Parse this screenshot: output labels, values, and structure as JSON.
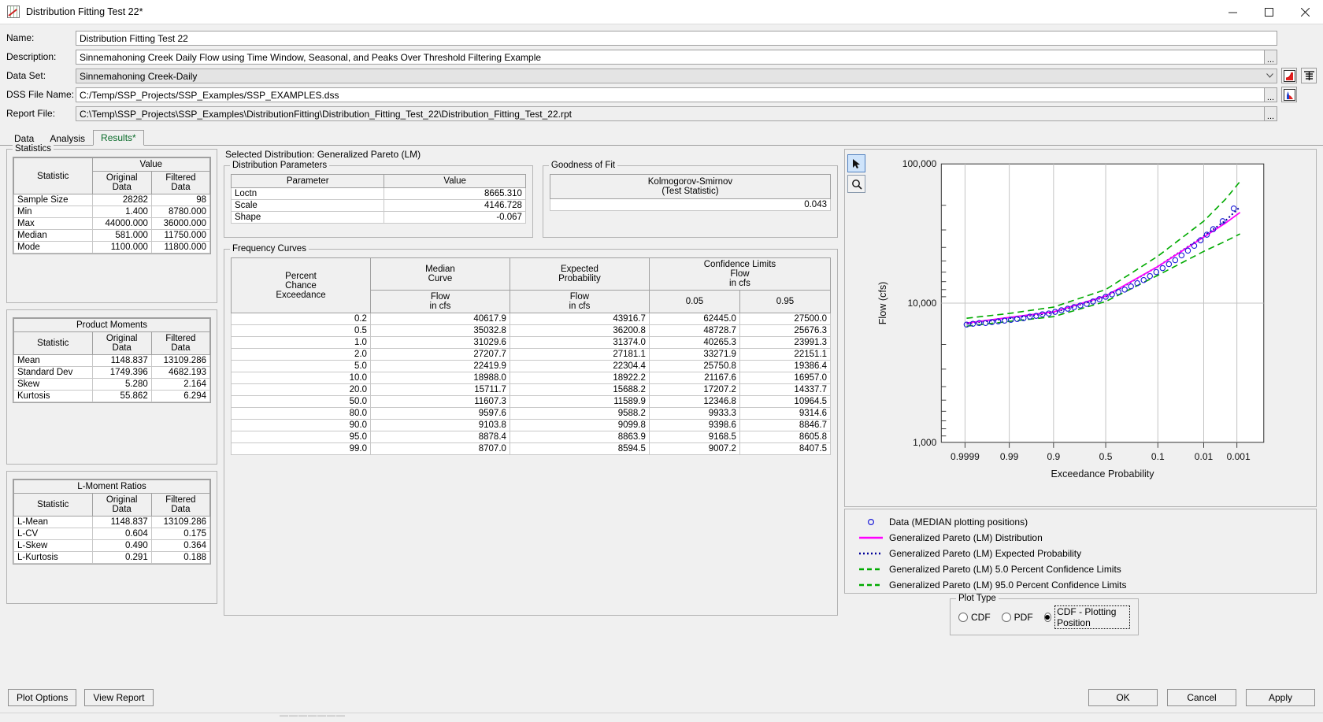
{
  "window": {
    "title": "Distribution Fitting Test 22*",
    "icon": "chart-icon",
    "minimize": "–",
    "maximize": "☐",
    "close": "✕"
  },
  "form": {
    "name_label": "Name:",
    "name_value": "Distribution Fitting Test 22",
    "description_label": "Description:",
    "description_value": "Sinnemahoning Creek Daily Flow using Time Window, Seasonal, and Peaks Over Threshold Filtering Example",
    "dataset_label": "Data Set:",
    "dataset_value": "Sinnemahoning Creek-Daily",
    "dss_label": "DSS File Name:",
    "dss_value": "C:/Temp/SSP_Projects/SSP_Examples/SSP_EXAMPLES.dss",
    "report_label": "Report File:",
    "report_value": "C:\\Temp\\SSP_Projects\\SSP_Examples\\DistributionFitting\\Distribution_Fitting_Test_22\\Distribution_Fitting_Test_22.rpt",
    "browse_label": "..."
  },
  "tabs": [
    {
      "label": "Data",
      "active": false
    },
    {
      "label": "Analysis",
      "active": false
    },
    {
      "label": "Results*",
      "active": true
    }
  ],
  "statistics": {
    "group_title": "Statistics",
    "header_statistic": "Statistic",
    "header_value": "Value",
    "header_original": "Original Data",
    "header_filtered": "Filtered Data",
    "rows": [
      {
        "stat": "Sample Size",
        "original": "28282",
        "filtered": "98"
      },
      {
        "stat": "Min",
        "original": "1.400",
        "filtered": "8780.000"
      },
      {
        "stat": "Max",
        "original": "44000.000",
        "filtered": "36000.000"
      },
      {
        "stat": "Median",
        "original": "581.000",
        "filtered": "11750.000"
      },
      {
        "stat": "Mode",
        "original": "1100.000",
        "filtered": "11800.000"
      }
    ]
  },
  "product_moments": {
    "title": "Product Moments",
    "header_statistic": "Statistic",
    "header_original": "Original Data",
    "header_filtered": "Filtered Data",
    "rows": [
      {
        "stat": "Mean",
        "original": "1148.837",
        "filtered": "13109.286"
      },
      {
        "stat": "Standard Dev",
        "original": "1749.396",
        "filtered": "4682.193"
      },
      {
        "stat": "Skew",
        "original": "5.280",
        "filtered": "2.164"
      },
      {
        "stat": "Kurtosis",
        "original": "55.862",
        "filtered": "6.294"
      }
    ]
  },
  "lmoment_ratios": {
    "title": "L-Moment Ratios",
    "header_statistic": "Statistic",
    "header_original": "Original Data",
    "header_filtered": "Filtered Data",
    "rows": [
      {
        "stat": "L-Mean",
        "original": "1148.837",
        "filtered": "13109.286"
      },
      {
        "stat": "L-CV",
        "original": "0.604",
        "filtered": "0.175"
      },
      {
        "stat": "L-Skew",
        "original": "0.490",
        "filtered": "0.364"
      },
      {
        "stat": "L-Kurtosis",
        "original": "0.291",
        "filtered": "0.188"
      }
    ]
  },
  "selected_distribution": "Selected Distribution: Generalized Pareto (LM)",
  "distribution_parameters": {
    "group_title": "Distribution Parameters",
    "header_parameter": "Parameter",
    "header_value": "Value",
    "rows": [
      {
        "parameter": "Loctn",
        "value": "8665.310"
      },
      {
        "parameter": "Scale",
        "value": "4146.728"
      },
      {
        "parameter": "Shape",
        "value": "-0.067"
      }
    ]
  },
  "goodness_of_fit": {
    "group_title": "Goodness of Fit",
    "header_line1": "Kolmogorov-Smirnov",
    "header_line2": "(Test Statistic)",
    "value": "0.043"
  },
  "frequency_curves": {
    "group_title": "Frequency Curves",
    "header_percent": "Percent\nChance\nExceedance",
    "header_percent_l1": "Percent",
    "header_percent_l2": "Chance",
    "header_percent_l3": "Exceedance",
    "header_median_l1": "Median",
    "header_median_l2": "Curve",
    "header_expected_l1": "Expected",
    "header_expected_l2": "Probability",
    "header_confidence_l1": "Confidence Limits",
    "header_confidence_l2": "Flow",
    "header_confidence_l3": "in cfs",
    "header_flow_l1": "Flow",
    "header_flow_l2": "in cfs",
    "header_cl_low": "0.05",
    "header_cl_high": "0.95",
    "rows": [
      {
        "pce": "0.2",
        "median": "40617.9",
        "expected": "43916.7",
        "cl05": "62445.0",
        "cl95": "27500.0"
      },
      {
        "pce": "0.5",
        "median": "35032.8",
        "expected": "36200.8",
        "cl05": "48728.7",
        "cl95": "25676.3"
      },
      {
        "pce": "1.0",
        "median": "31029.6",
        "expected": "31374.0",
        "cl05": "40265.3",
        "cl95": "23991.3"
      },
      {
        "pce": "2.0",
        "median": "27207.7",
        "expected": "27181.1",
        "cl05": "33271.9",
        "cl95": "22151.1"
      },
      {
        "pce": "5.0",
        "median": "22419.9",
        "expected": "22304.4",
        "cl05": "25750.8",
        "cl95": "19386.4"
      },
      {
        "pce": "10.0",
        "median": "18988.0",
        "expected": "18922.2",
        "cl05": "21167.6",
        "cl95": "16957.0"
      },
      {
        "pce": "20.0",
        "median": "15711.7",
        "expected": "15688.2",
        "cl05": "17207.2",
        "cl95": "14337.7"
      },
      {
        "pce": "50.0",
        "median": "11607.3",
        "expected": "11589.9",
        "cl05": "12346.8",
        "cl95": "10964.5"
      },
      {
        "pce": "80.0",
        "median": "9597.6",
        "expected": "9588.2",
        "cl05": "9933.3",
        "cl95": "9314.6"
      },
      {
        "pce": "90.0",
        "median": "9103.8",
        "expected": "9099.8",
        "cl05": "9398.6",
        "cl95": "8846.7"
      },
      {
        "pce": "95.0",
        "median": "8878.4",
        "expected": "8863.9",
        "cl05": "9168.5",
        "cl95": "8605.8"
      },
      {
        "pce": "99.0",
        "median": "8707.0",
        "expected": "8594.5",
        "cl05": "9007.2",
        "cl95": "8407.5"
      }
    ]
  },
  "chart_data": {
    "type": "line",
    "title": "",
    "xlabel": "Exceedance Probability",
    "ylabel": "Flow (cfs)",
    "yscale": "log",
    "ylim": [
      1000,
      100000
    ],
    "ytick_labels": [
      "100,000",
      "10,000",
      "1,000"
    ],
    "xscale": "normal-probability",
    "xtick_labels": [
      "0.9999",
      "0.99",
      "0.9",
      "0.5",
      "0.1",
      "0.01",
      "0.001"
    ],
    "grid": true,
    "legend_position": "below",
    "series": [
      {
        "name": "Data (MEDIAN plotting positions)",
        "style": "circles",
        "color": "#1c1cd8",
        "x": [
          0.99,
          0.985,
          0.975,
          0.965,
          0.955,
          0.945,
          0.93,
          0.915,
          0.9,
          0.88,
          0.86,
          0.84,
          0.82,
          0.8,
          0.78,
          0.76,
          0.74,
          0.72,
          0.7,
          0.68,
          0.66,
          0.64,
          0.62,
          0.6,
          0.58,
          0.56,
          0.54,
          0.52,
          0.5,
          0.48,
          0.46,
          0.44,
          0.42,
          0.4,
          0.38,
          0.36,
          0.34,
          0.32,
          0.3,
          0.28,
          0.26,
          0.24,
          0.22,
          0.2,
          0.18,
          0.16,
          0.14,
          0.12,
          0.1,
          0.085,
          0.07,
          0.058,
          0.047,
          0.038,
          0.03,
          0.023,
          0.017,
          0.012,
          0.008,
          0.005
        ],
        "y": [
          8780,
          8800,
          8830,
          8870,
          8900,
          8950,
          9000,
          9050,
          9100,
          9180,
          9260,
          9340,
          9420,
          9500,
          9600,
          9700,
          9800,
          9900,
          10000,
          10150,
          10300,
          10450,
          10600,
          10800,
          11000,
          11200,
          11400,
          11600,
          11750,
          12000,
          12250,
          12500,
          12750,
          13000,
          13300,
          13600,
          13900,
          14200,
          14600,
          15000,
          15400,
          15900,
          16400,
          17000,
          17600,
          18300,
          19000,
          19800,
          20700,
          21600,
          22600,
          23700,
          24900,
          26200,
          27500,
          29000,
          30800,
          33000,
          36000,
          36000
        ]
      },
      {
        "name": "Generalized Pareto (LM) Distribution",
        "style": "solid",
        "color": "#ff00ff",
        "x": [
          0.99,
          0.95,
          0.9,
          0.8,
          0.5,
          0.2,
          0.1,
          0.05,
          0.02,
          0.01,
          0.005,
          0.002
        ],
        "y": [
          8707.0,
          8878.4,
          9103.8,
          9597.6,
          11607.3,
          15711.7,
          18988.0,
          22419.9,
          27207.7,
          31029.6,
          35032.8,
          40617.9
        ]
      },
      {
        "name": "Generalized Pareto (LM) Expected Probability",
        "style": "dotted",
        "color": "#000099",
        "x": [
          0.99,
          0.95,
          0.9,
          0.8,
          0.5,
          0.2,
          0.1,
          0.05,
          0.02,
          0.01,
          0.005,
          0.002
        ],
        "y": [
          8594.5,
          8863.9,
          9099.8,
          9588.2,
          11589.9,
          15688.2,
          18922.2,
          22304.4,
          27181.1,
          31374.0,
          36200.8,
          43916.7
        ]
      },
      {
        "name": "Generalized Pareto (LM) 5.0 Percent Confidence Limits",
        "style": "dashed",
        "color": "#00aa00",
        "x": [
          0.99,
          0.95,
          0.9,
          0.8,
          0.5,
          0.2,
          0.1,
          0.05,
          0.02,
          0.01,
          0.005,
          0.002
        ],
        "y": [
          9007.2,
          9168.5,
          9398.6,
          9933.3,
          12346.8,
          17207.2,
          21167.6,
          25750.8,
          33271.9,
          40265.3,
          48728.7,
          62445.0
        ]
      },
      {
        "name": "Generalized Pareto (LM) 95.0 Percent Confidence Limits",
        "style": "dashed",
        "color": "#00aa00",
        "x": [
          0.99,
          0.95,
          0.9,
          0.8,
          0.5,
          0.2,
          0.1,
          0.05,
          0.02,
          0.01,
          0.005,
          0.002
        ],
        "y": [
          8407.5,
          8605.8,
          8846.7,
          9314.6,
          10964.5,
          14337.7,
          16957.0,
          19386.4,
          22151.1,
          23991.3,
          25676.3,
          27500.0
        ]
      }
    ]
  },
  "legend": [
    {
      "label": "Data (MEDIAN plotting positions)",
      "symbol": "circle",
      "color": "#1c1cd8"
    },
    {
      "label": "Generalized Pareto (LM) Distribution",
      "symbol": "solid",
      "color": "#ff00ff"
    },
    {
      "label": "Generalized Pareto (LM) Expected Probability",
      "symbol": "dotted",
      "color": "#000099"
    },
    {
      "label": "Generalized Pareto (LM) 5.0 Percent Confidence Limits",
      "symbol": "dashed",
      "color": "#00aa00"
    },
    {
      "label": "Generalized Pareto (LM) 95.0 Percent Confidence Limits",
      "symbol": "dashed",
      "color": "#00aa00"
    }
  ],
  "plot_type": {
    "group_title": "Plot Type",
    "options": [
      {
        "label": "CDF",
        "selected": false
      },
      {
        "label": "PDF",
        "selected": false
      },
      {
        "label": "CDF - Plotting Position",
        "selected": true
      }
    ]
  },
  "buttons": {
    "plot_options": "Plot Options",
    "view_report": "View Report",
    "ok": "OK",
    "cancel": "Cancel",
    "apply": "Apply"
  },
  "colors": {
    "accent_tab": "#0a6b2a",
    "data_blue": "#1c1cd8",
    "distribution_magenta": "#ff00ff",
    "expected_navy": "#000099",
    "confidence_green": "#00aa00"
  }
}
